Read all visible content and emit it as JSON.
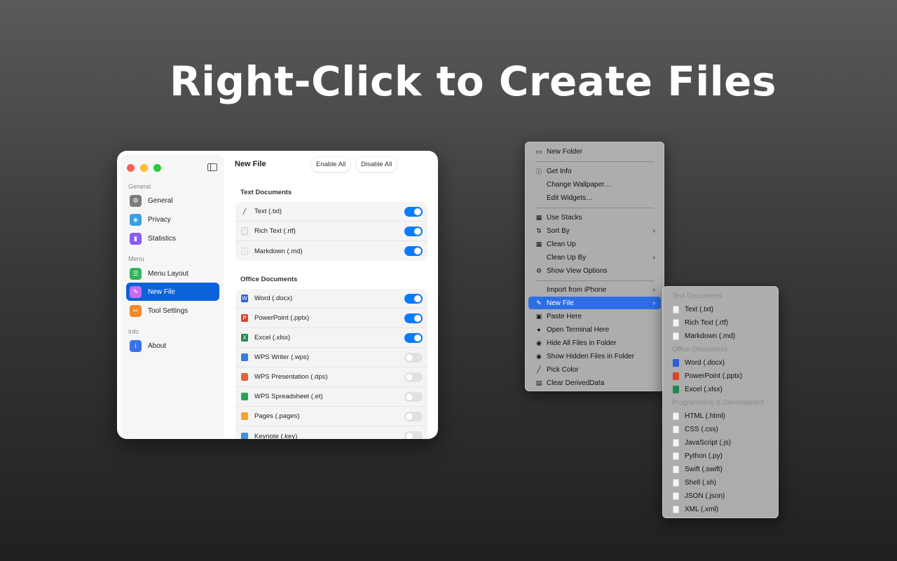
{
  "hero": {
    "title": "Right-Click to Create Files"
  },
  "colors": {
    "accent": "#0a63d8",
    "toggle_on": "#0a7bff",
    "menu_highlight": "#2d6ee6"
  },
  "window": {
    "title": "New File",
    "enable_all": "Enable All",
    "disable_all": "Disable All",
    "sidebar": {
      "sections": [
        "General",
        "Menu",
        "Info"
      ],
      "items": [
        {
          "label": "General",
          "icon": "gear-icon",
          "color": "#7c7c80"
        },
        {
          "label": "Privacy",
          "icon": "shield-icon",
          "color": "#3aa0e0"
        },
        {
          "label": "Statistics",
          "icon": "chart-icon",
          "color": "#8a5cf0"
        },
        {
          "label": "Menu Layout",
          "icon": "menu-layout-icon",
          "color": "#34b35b"
        },
        {
          "label": "New File",
          "icon": "new-file-icon",
          "color": "#c56cf0"
        },
        {
          "label": "Tool Settings",
          "icon": "tools-icon",
          "color": "#f08a2a"
        },
        {
          "label": "About",
          "icon": "info-icon",
          "color": "#3a73e8"
        }
      ]
    },
    "groups": [
      {
        "title": "Text Documents",
        "rows": [
          {
            "label": "Text (.txt)",
            "on": true
          },
          {
            "label": "Rich Text (.rtf)",
            "on": true
          },
          {
            "label": "Markdown (.md)",
            "on": true
          }
        ]
      },
      {
        "title": "Office Documents",
        "rows": [
          {
            "label": "Word (.docx)",
            "on": true
          },
          {
            "label": "PowerPoint (.pptx)",
            "on": true
          },
          {
            "label": "Excel (.xlsx)",
            "on": true
          },
          {
            "label": "WPS Writer (.wps)",
            "on": false
          },
          {
            "label": "WPS Presentation (.dps)",
            "on": false
          },
          {
            "label": "WPS Spreadsheet (.et)",
            "on": false
          },
          {
            "label": "Pages (.pages)",
            "on": false
          },
          {
            "label": "Keynote (.key)",
            "on": false
          }
        ]
      }
    ]
  },
  "context_menu": {
    "items": [
      {
        "label": "New Folder",
        "icon": "folder-plus-icon"
      },
      {
        "label": "Get Info",
        "icon": "info-icon"
      },
      {
        "label": "Change Wallpaper…",
        "icon": ""
      },
      {
        "label": "Edit Widgets…",
        "icon": ""
      },
      {
        "label": "Use Stacks",
        "icon": "stacks-icon"
      },
      {
        "label": "Sort By",
        "icon": "sort-icon",
        "submenu": true
      },
      {
        "label": "Clean Up",
        "icon": "grid-icon"
      },
      {
        "label": "Clean Up By",
        "icon": "",
        "submenu": true
      },
      {
        "label": "Show View Options",
        "icon": "gear-icon"
      },
      {
        "label": "Import from iPhone",
        "icon": "",
        "submenu": true
      },
      {
        "label": "New File",
        "icon": "new-file-icon",
        "submenu": true,
        "highlighted": true
      },
      {
        "label": "Paste Here",
        "icon": "clipboard-icon"
      },
      {
        "label": "Open Terminal Here",
        "icon": "terminal-icon"
      },
      {
        "label": "Hide All Files in Folder",
        "icon": "eye-slash-icon"
      },
      {
        "label": "Show Hidden Files in Folder",
        "icon": "eye-icon"
      },
      {
        "label": "Pick Color",
        "icon": "eyedropper-icon"
      },
      {
        "label": "Clear DerivedData",
        "icon": "trash-icon"
      }
    ]
  },
  "submenu": {
    "sections": [
      "Text Documents",
      "Office Documents",
      "Programming & Development"
    ],
    "items": [
      "Text (.txt)",
      "Rich Text (.rtf)",
      "Markdown (.md)",
      "Word (.docx)",
      "PowerPoint (.pptx)",
      "Excel (.xlsx)",
      "HTML (.html)",
      "CSS (.css)",
      "JavaScript (.js)",
      "Python (.py)",
      "Swift (.swift)",
      "Shell (.sh)",
      "JSON (.json)",
      "XML (.xml)"
    ]
  }
}
